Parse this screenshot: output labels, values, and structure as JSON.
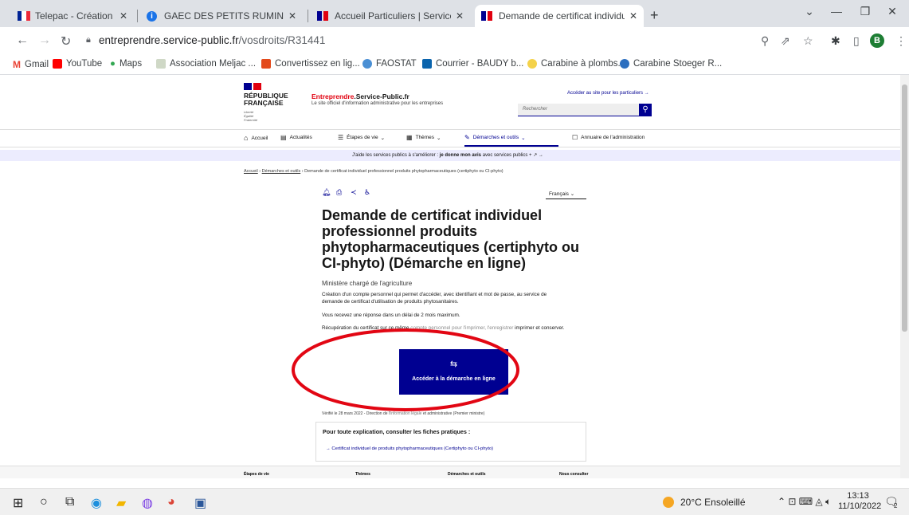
{
  "browser": {
    "tabs": [
      {
        "title": "Telepac - Création du compte / n",
        "icon": "flag-fr-icon"
      },
      {
        "title": "GAEC DES PETITS RUMINANTS (",
        "icon": "info-icon"
      },
      {
        "title": "Accueil Particuliers | Service-publ",
        "icon": "marianne-icon"
      },
      {
        "title": "Demande de certificat individuel",
        "icon": "marianne-icon"
      }
    ],
    "url_host": "entreprendre.service-public.fr",
    "url_path": "/vosdroits/R31441",
    "profile_initial": "B",
    "bookmarks": [
      "Gmail",
      "YouTube",
      "Maps",
      "Association Meljac ...",
      "Convertissez en lig...",
      "FAOSTAT",
      "Courrier - BAUDY b...",
      "Carabine à plombs...",
      "Carabine Stoeger R..."
    ]
  },
  "site": {
    "rf_lines": [
      "RÉPUBLIQUE",
      "FRANÇAISE"
    ],
    "devise": [
      "Liberté",
      "Égalité",
      "Fraternité"
    ],
    "brand_bold": "Entreprendre",
    "brand_rest": ".Service-Public.fr",
    "tagline": "Le site officiel d'information administrative pour les entreprises",
    "particuliers_link": "Accéder au site pour les particuliers →",
    "search_placeholder": "Rechercher",
    "nav": [
      "Accueil",
      "Actualités",
      "Étapes de vie",
      "Thèmes",
      "Démarches et outils",
      "Annuaire de l'administration"
    ],
    "banner_pre": "J'aide les services publics à s'améliorer : ",
    "banner_link": "je donne mon avis",
    "banner_post": " avec services publics +  ↗  →",
    "breadcrumb": [
      "Accueil",
      "Démarches et outils",
      "Demande de certificat individuel professionnel produits phytopharmaceutiques (certiphyto ou CI-phyto)"
    ],
    "language": "Français",
    "title_lines": [
      "Demande de certificat individuel",
      "professionnel produits",
      "phytopharmaceutiques (certiphyto ou",
      "CI-phyto) (Démarche en ligne)"
    ],
    "ministry": "Ministère chargé de l'agriculture",
    "desc_lines": [
      "Création d'un compte personnel qui permet d'accéder, avec identifiant et mot de passe, au service de",
      "demande de certificat d'utilisation de produits phytosanitaires."
    ],
    "delay": "Vous recevez une réponse dans un délai de 2 mois maximum.",
    "recup_pre": "Récupération du certificat sur ce même ",
    "recup_hidden": "compte personnel pour l'imprimer, l'enregistrer",
    "recup_post": " imprimer et conserver.",
    "cta_label": "Accéder à la démarche en ligne",
    "verified_pre": "Vérifié le 28 mars 2022 - Direction de l'",
    "verified_hidden": "information légale",
    "verified_post": " et administrative (Premier ministre)",
    "fiches_title": "Pour toute explication, consulter les fiches pratiques :",
    "fiche_link": "Certificat individuel de produits phytopharmaceutiques (Certiphyto ou CI-phyto)",
    "footer_cols": [
      "Étapes de vie",
      "Thèmes",
      "Démarches et outils",
      "Nous consulter"
    ]
  },
  "taskbar": {
    "weather": "20°C  Ensoleillé",
    "time": "13:13",
    "date": "11/10/2022",
    "notif_count": "2"
  },
  "colors": {
    "accent": "#000091",
    "marianne_red": "#e1000f",
    "annotation": "#e20613"
  }
}
